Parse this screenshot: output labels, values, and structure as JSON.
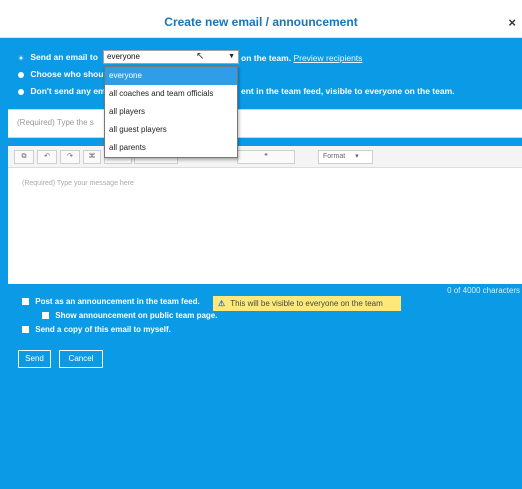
{
  "dialog": {
    "title": "Create new email / announcement",
    "close": "×"
  },
  "options": {
    "send_prefix": "Send an email to",
    "send_suffix": "on the team.",
    "preview": "Preview recipients",
    "choose": "Choose who should",
    "dont_send": "Don't send any email",
    "team_feed": "ent in the team feed, visible to everyone on the team."
  },
  "recipient_select": {
    "selected": "everyone",
    "options": [
      "everyone",
      "all coaches and team officials",
      "all players",
      "all guest players",
      "all parents"
    ]
  },
  "subject": {
    "placeholder": "(Required) Type the s"
  },
  "toolbar": {
    "format_label": "Format"
  },
  "editor": {
    "placeholder": "(Required) Type your message here"
  },
  "footer": {
    "char_count": "0 of 4000 characters",
    "post_announcement": "Post as an announcement in the team feed.",
    "visibility_notice": "This will be visible to everyone on the team",
    "public_page": "Show announcement on public team page.",
    "copy_to_me": "Send a copy of this email to myself.",
    "send": "Send",
    "cancel": "Cancel"
  },
  "colors": {
    "accent": "#0a9ae6",
    "title": "#1876b8",
    "notice": "#ffe87a"
  },
  "icons": [
    "close-icon",
    "pointer-cursor-icon",
    "warning-icon",
    "clipboard-icon",
    "undo-icon",
    "redo-icon",
    "link-icon",
    "list-icon",
    "indent-icon",
    "quote-icon",
    "format-chevron-icon"
  ]
}
